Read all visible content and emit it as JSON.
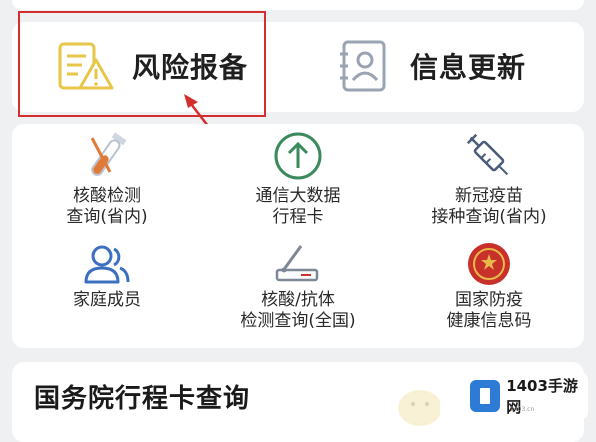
{
  "quick_actions": {
    "risk_report": "风险报备",
    "info_update": "信息更新"
  },
  "services": [
    {
      "label": "核酸检测\n查询(省内)",
      "icon": "test-tube-icon"
    },
    {
      "label": "通信大数据\n行程卡",
      "icon": "upload-arrow-icon"
    },
    {
      "label": "新冠疫苗\n接种查询(省内)",
      "icon": "syringe-icon"
    },
    {
      "label": "家庭成员",
      "icon": "people-icon"
    },
    {
      "label": "核酸/抗体\n检测查询(全国)",
      "icon": "test-pen-icon"
    },
    {
      "label": "国家防疫\n健康信息码",
      "icon": "national-emblem-icon"
    }
  ],
  "bottom": {
    "title": "国务院行程卡查询"
  },
  "watermark": {
    "brand": "1403手游网",
    "sub": "1403.cn"
  },
  "colors": {
    "highlight": "#d1302f",
    "accent_yellow": "#e7c64a",
    "icon_blue": "#3b6fbf",
    "icon_green": "#3a8a5c"
  }
}
